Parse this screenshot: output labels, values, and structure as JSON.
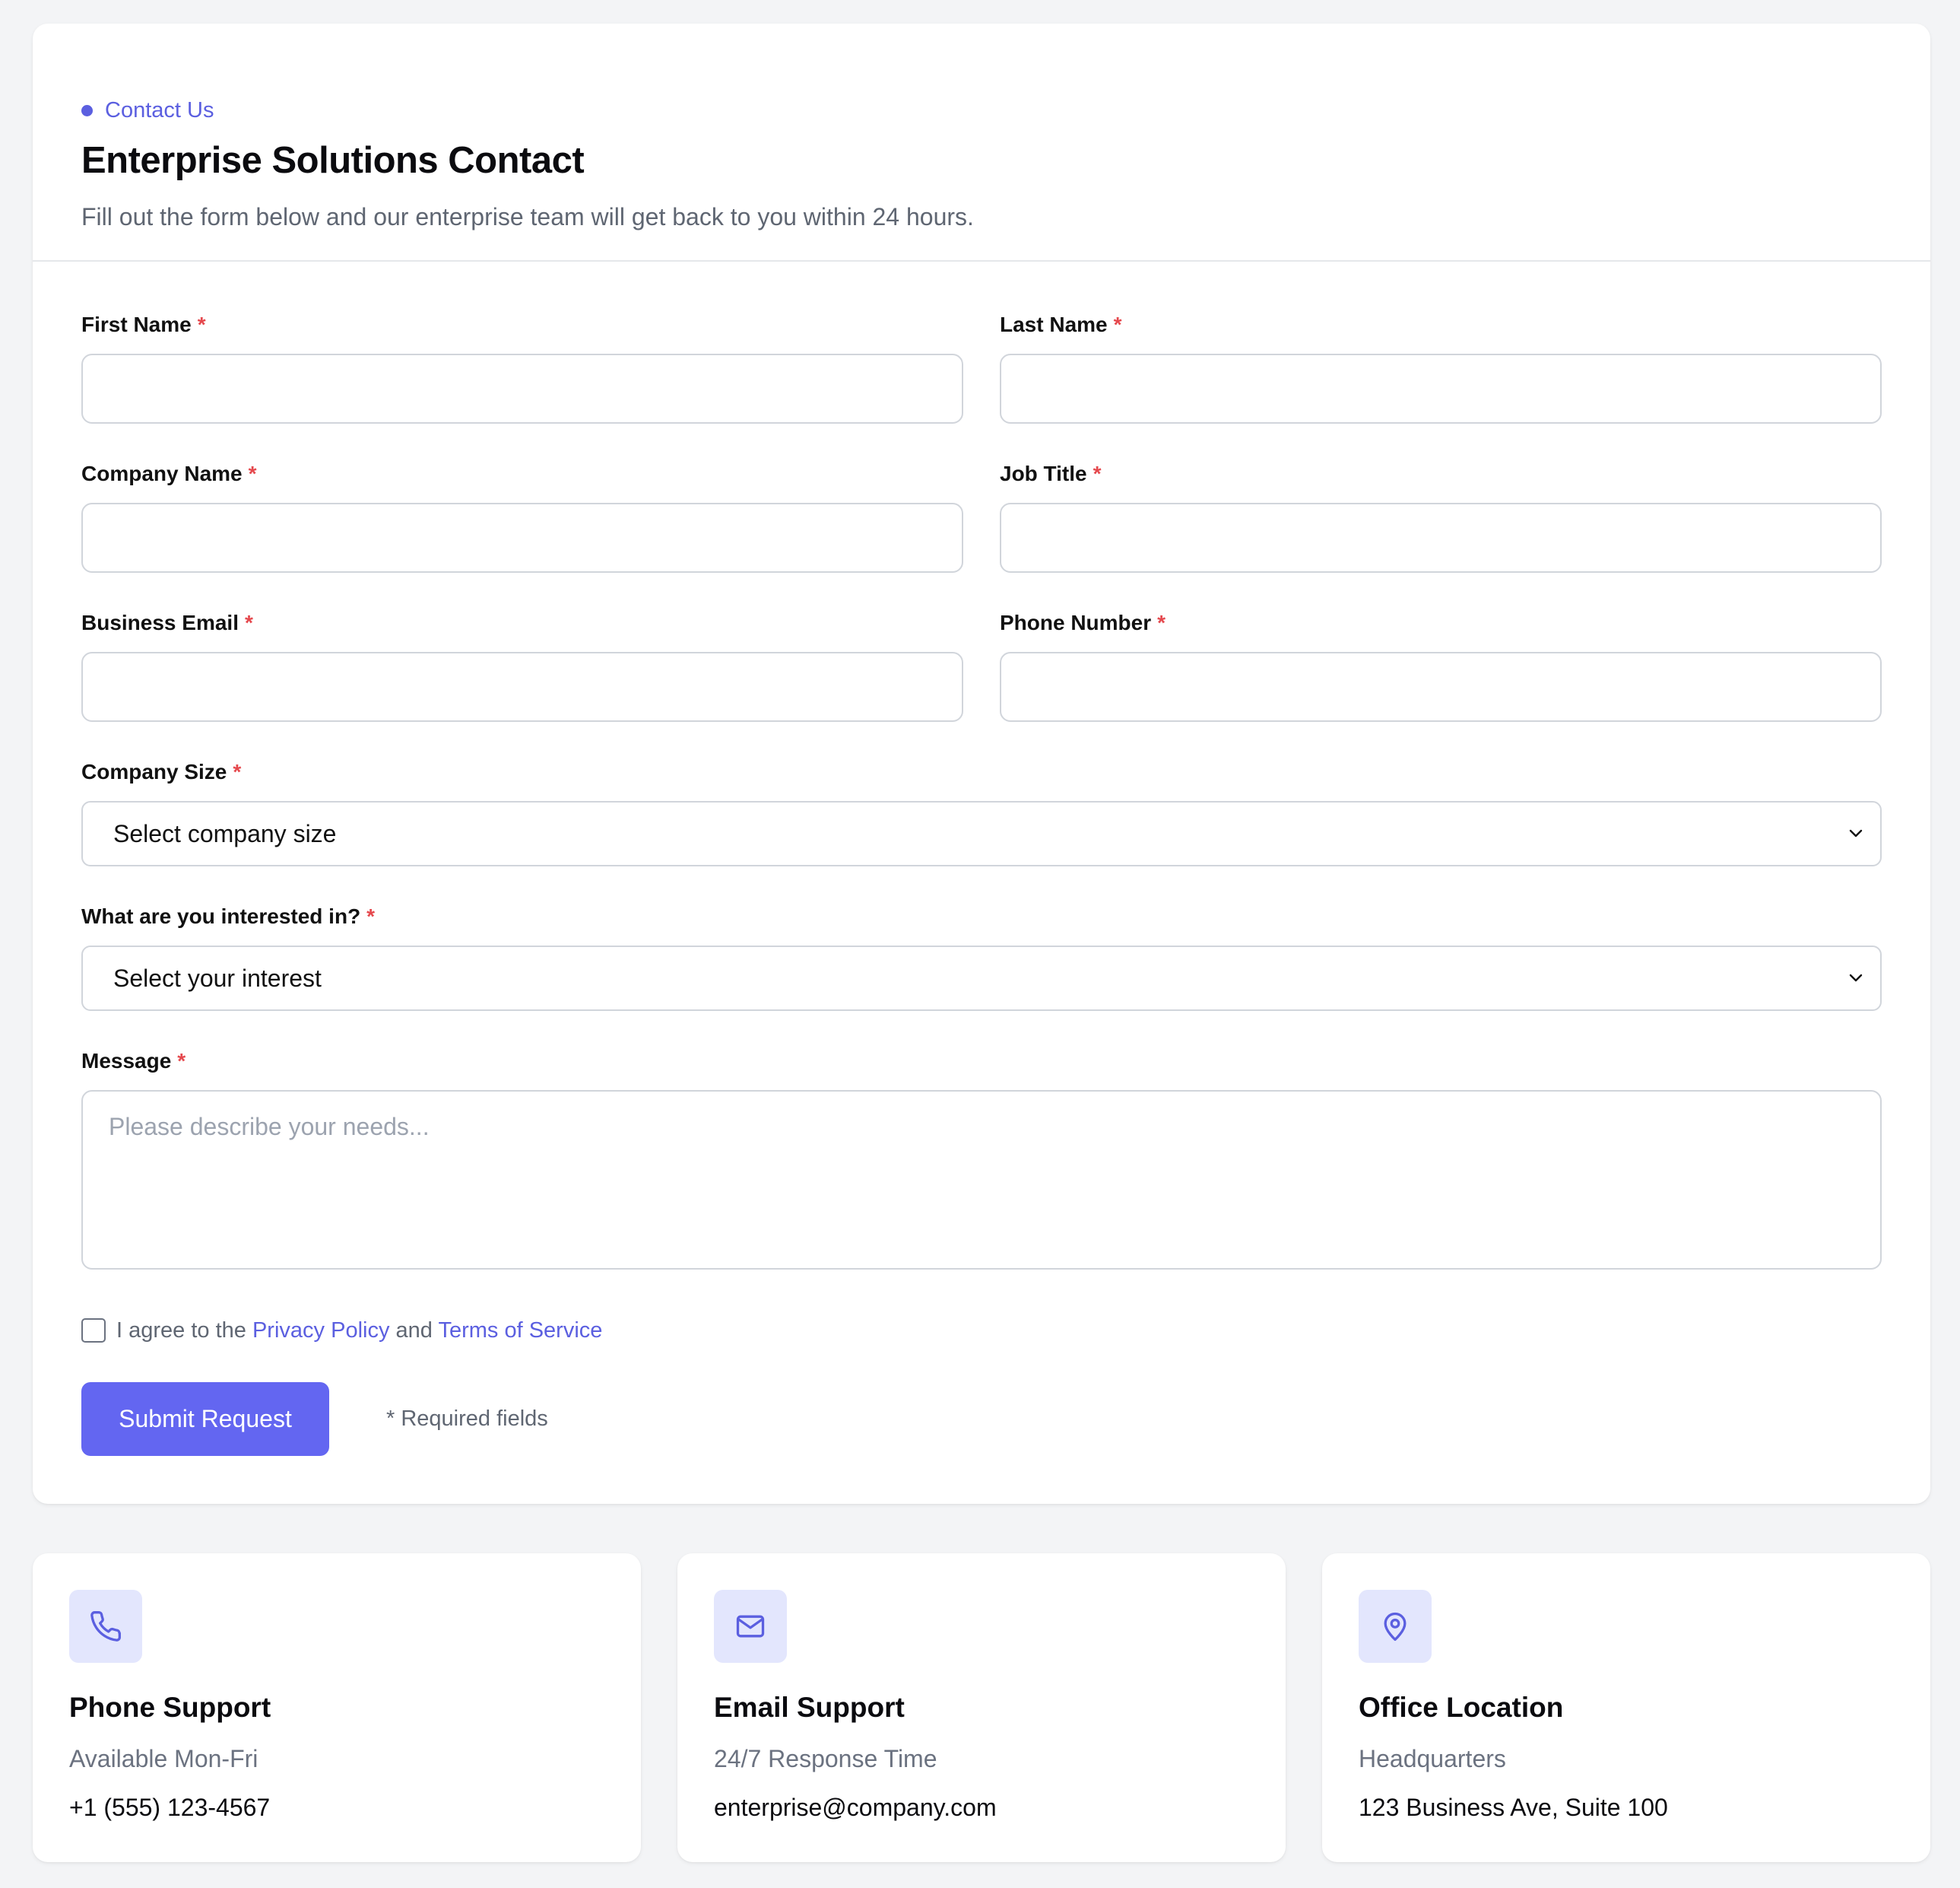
{
  "header": {
    "eyebrow": "Contact Us",
    "title": "Enterprise Solutions Contact",
    "subtitle": "Fill out the form below and our enterprise team will get back to you within 24 hours."
  },
  "form": {
    "required_mark": "*",
    "first_name_label": "First Name",
    "first_name_value": "",
    "last_name_label": "Last Name",
    "last_name_value": "",
    "company_name_label": "Company Name",
    "company_name_value": "",
    "job_title_label": "Job Title",
    "job_title_value": "",
    "business_email_label": "Business Email",
    "business_email_value": "",
    "phone_number_label": "Phone Number",
    "phone_number_value": "",
    "company_size_label": "Company Size",
    "company_size_selected": "Select company size",
    "interest_label": "What are you interested in?",
    "interest_selected": "Select your interest",
    "message_label": "Message",
    "message_placeholder": "Please describe your needs...",
    "consent_prefix": "I agree to the",
    "consent_privacy": "Privacy Policy",
    "consent_and": "and",
    "consent_terms": "Terms of Service",
    "submit_label": "Submit Request",
    "required_note": "* Required fields"
  },
  "info_cards": [
    {
      "icon": "phone-icon",
      "title": "Phone Support",
      "subtitle": "Available Mon-Fri",
      "value": "+1 (555) 123-4567"
    },
    {
      "icon": "mail-icon",
      "title": "Email Support",
      "subtitle": "24/7 Response Time",
      "value": "enterprise@company.com"
    },
    {
      "icon": "map-pin-icon",
      "title": "Office Location",
      "subtitle": "Headquarters",
      "value": "123 Business Ave, Suite 100"
    }
  ],
  "colors": {
    "accent": "#6366f1",
    "link": "#5b5fe0",
    "required": "#e5484d",
    "icon_bg": "#e3e6fd",
    "page_bg": "#f3f4f6"
  }
}
